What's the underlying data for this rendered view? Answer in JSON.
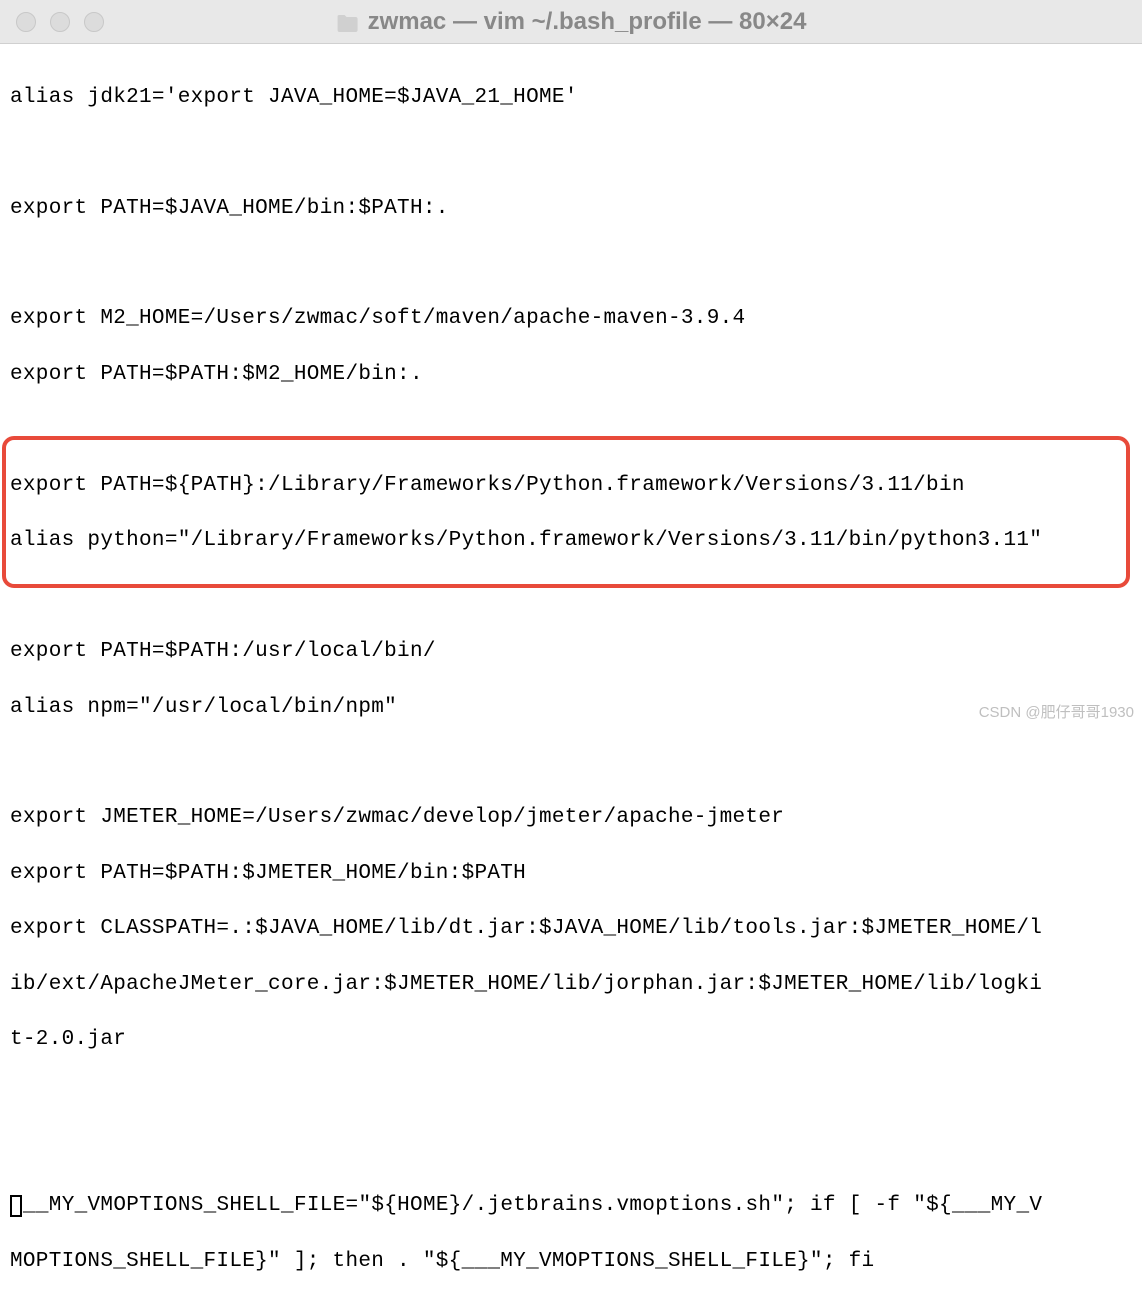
{
  "window": {
    "title": "zwmac — vim ~/.bash_profile — 80×24"
  },
  "lines": {
    "l0": "alias jdk21='export JAVA_HOME=$JAVA_21_HOME'",
    "l1": "",
    "l2": "export PATH=$JAVA_HOME/bin:$PATH:.",
    "l3": "",
    "l4": "export M2_HOME=/Users/zwmac/soft/maven/apache-maven-3.9.4",
    "l5": "export PATH=$PATH:$M2_HOME/bin:.",
    "l6": "",
    "l7": "export PATH=${PATH}:/Library/Frameworks/Python.framework/Versions/3.11/bin",
    "l8": "alias python=\"/Library/Frameworks/Python.framework/Versions/3.11/bin/python3.11\"",
    "l9": "",
    "l10": "export PATH=$PATH:/usr/local/bin/",
    "l11": "alias npm=\"/usr/local/bin/npm\"",
    "l12": "",
    "l13": "export JMETER_HOME=/Users/zwmac/develop/jmeter/apache-jmeter",
    "l14": "export PATH=$PATH:$JMETER_HOME/bin:$PATH",
    "l15": "export CLASSPATH=.:$JAVA_HOME/lib/dt.jar:$JAVA_HOME/lib/tools.jar:$JMETER_HOME/l",
    "l16": "ib/ext/ApacheJMeter_core.jar:$JMETER_HOME/lib/jorphan.jar:$JMETER_HOME/lib/logki",
    "l17": "t-2.0.jar",
    "l18": "",
    "l19": "",
    "l20a": "__MY_VMOPTIONS_SHELL_FILE=\"${HOME}/.jetbrains.vmoptions.sh\"; if [ -f \"${___MY_V",
    "l21": "MOPTIONS_SHELL_FILE}\" ]; then . \"${___MY_VMOPTIONS_SHELL_FILE}\"; fi"
  },
  "watermark": "CSDN @肥仔哥哥1930"
}
